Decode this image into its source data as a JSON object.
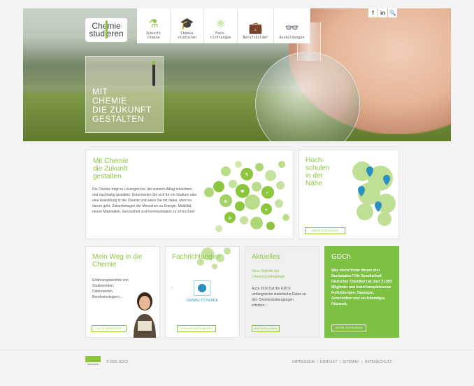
{
  "header": {
    "logo_text_top": "Chemie",
    "logo_text_bottom": "studieren",
    "nav": [
      {
        "icon": "test-tube-icon",
        "glyph": "⚗",
        "label": "Zukunft\nChemie"
      },
      {
        "icon": "graduation-cap-icon",
        "glyph": "🎓",
        "label": "Chemie\nstudieren"
      },
      {
        "icon": "molecule-icon",
        "glyph": "⚛",
        "label": "Fach-\nrichtungen"
      },
      {
        "icon": "briefcase-icon",
        "glyph": "💼",
        "label": "Berufsbilder"
      },
      {
        "icon": "glasses-icon",
        "glyph": "👓",
        "label": "Ausbildungen"
      }
    ],
    "social": {
      "facebook": "f",
      "linkedin": "in",
      "search": "🔍"
    }
  },
  "hero": {
    "claim": "MIT\nCHEMIE\nDIE ZUKUNFT\nGESTALTEN"
  },
  "cards": {
    "zukunft": {
      "title": "Mit Chemie\ndie Zukunft\ngestalten",
      "text": "Die Chemie trägt zu Lösungen bei, die unseren Alltag erleichtern und nachhaltig gestalten. Entscheiden Sie sich für ein Studium oder eine Ausbildung in der Chemie und seien Sie mit dabei, wenn es darum geht, Zukunftsfragen der Menschen zu Energie, Mobilität, neuen Materialien, Gesundheit und Kommunikation zu erforschen!"
    },
    "hochschulen": {
      "title": "Hoch-\nschulen\nin der\nNähe",
      "button": "MEHR ERFAHREN"
    },
    "weg": {
      "title": "Mein Weg in die\nChemie",
      "text": "Erfahrungsberichte von Studierenden, Doktoranden, Berufseinsteigern ...",
      "button": "ALLE BERICHTE"
    },
    "fachrichtungen": {
      "title": "Fachrichtungen",
      "topic": "UMWELTCHEMIE",
      "button": "ZUR FACHRICHTUNG"
    },
    "aktuelles": {
      "title": "Aktuelles",
      "subtitle": "Neue Statistik der Chemiestudiengänge",
      "text": "Auch 2016 hat die GDCh umfangreiche statistische Daten zu den Chemiestudiengängen erhoben...",
      "button": "WEITERLESEN"
    },
    "gdch": {
      "title": "GDCh",
      "text": "Was steckt hinter diesen drei Buchstaben? Die Gesellschaft Deutscher Chemiker hat über 31.000 Mitglieder und bietet beispielsweise Fortbildungen, Tagungen, Zeitschriften und ein lebendiges Netzwerk.",
      "button": "MEHR ERFAHREN"
    }
  },
  "footer": {
    "copyright": "© 2016 GDCh",
    "links": "IMPRESSUM  |  KONTAKT  |  SITEMAP  |  DATENSCHUTZ"
  },
  "colors": {
    "accent": "#8cc63f",
    "gdch_green": "#7cc142",
    "pin_blue": "#2a8fc1"
  }
}
